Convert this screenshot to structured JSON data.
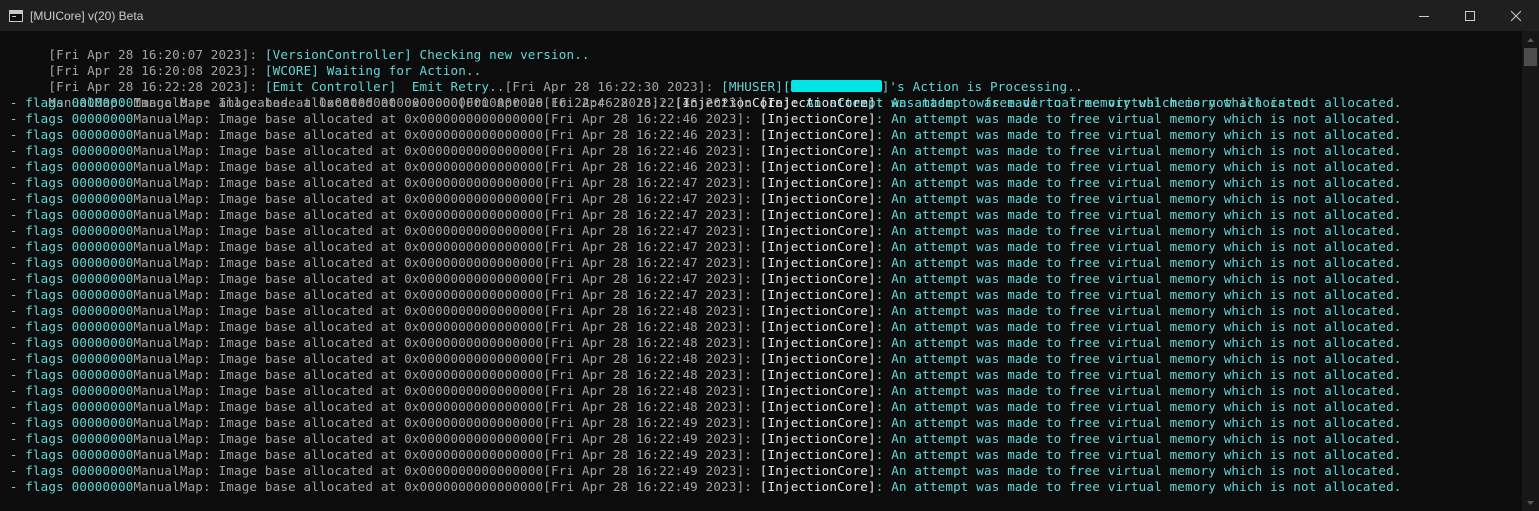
{
  "window": {
    "title": "[MUICore] v(20) Beta",
    "icon": "console-app-icon",
    "controls": [
      "minimize-icon",
      "maximize-icon",
      "close-icon"
    ]
  },
  "colors": {
    "background": "#0c0c0c",
    "titlebar": "#1f1f1f",
    "timestamp_gray": "#a3a3a3",
    "message_cyan": "#61d6d6",
    "redaction": "#00e5e5"
  },
  "console": {
    "header_lines": [
      {
        "ts": "[Fri Apr 28 16:20:07 2023]: ",
        "msg": "[VersionController] Checking new version.."
      },
      {
        "ts": "[Fri Apr 28 16:20:08 2023]: ",
        "msg": "[WCORE] Waiting for Action.."
      },
      {
        "ts": "[Fri Apr 28 16:22:28 2023]: ",
        "msg": "[Emit Controller]  Emit Retry..",
        "ts2": "[Fri Apr 28 16:22:30 2023]: ",
        "msg2_prefix": "[MHUSER][",
        "msg2_suffix": "]'s Action is Processing.."
      },
      {
        "pre": "ManualMap: Image base allocated at 0x0000000000000000",
        "ts": "[Fri Apr 28 16:22:46 2023]: ",
        "tag": "[InjectionCore]",
        "msg": ": An attempt was made to free virtual memory which is not allocated."
      }
    ],
    "repeat_line": {
      "flags_prefix": " - flags ",
      "flags_value": "00000000",
      "manualmap": "ManualMap: Image base allocated at 0x0000000000000000",
      "tag": "[InjectionCore]",
      "msg": ": An attempt was made to free virtual memory which is not allocated."
    },
    "repeat_timestamps": [
      "[Fri Apr 28 16:22:46 2023]: ",
      "[Fri Apr 28 16:22:46 2023]: ",
      "[Fri Apr 28 16:22:46 2023]: ",
      "[Fri Apr 28 16:22:46 2023]: ",
      "[Fri Apr 28 16:22:46 2023]: ",
      "[Fri Apr 28 16:22:47 2023]: ",
      "[Fri Apr 28 16:22:47 2023]: ",
      "[Fri Apr 28 16:22:47 2023]: ",
      "[Fri Apr 28 16:22:47 2023]: ",
      "[Fri Apr 28 16:22:47 2023]: ",
      "[Fri Apr 28 16:22:47 2023]: ",
      "[Fri Apr 28 16:22:47 2023]: ",
      "[Fri Apr 28 16:22:47 2023]: ",
      "[Fri Apr 28 16:22:48 2023]: ",
      "[Fri Apr 28 16:22:48 2023]: ",
      "[Fri Apr 28 16:22:48 2023]: ",
      "[Fri Apr 28 16:22:48 2023]: ",
      "[Fri Apr 28 16:22:48 2023]: ",
      "[Fri Apr 28 16:22:48 2023]: ",
      "[Fri Apr 28 16:22:48 2023]: ",
      "[Fri Apr 28 16:22:49 2023]: ",
      "[Fri Apr 28 16:22:49 2023]: ",
      "[Fri Apr 28 16:22:49 2023]: ",
      "[Fri Apr 28 16:22:49 2023]: ",
      "[Fri Apr 28 16:22:49 2023]: "
    ]
  }
}
